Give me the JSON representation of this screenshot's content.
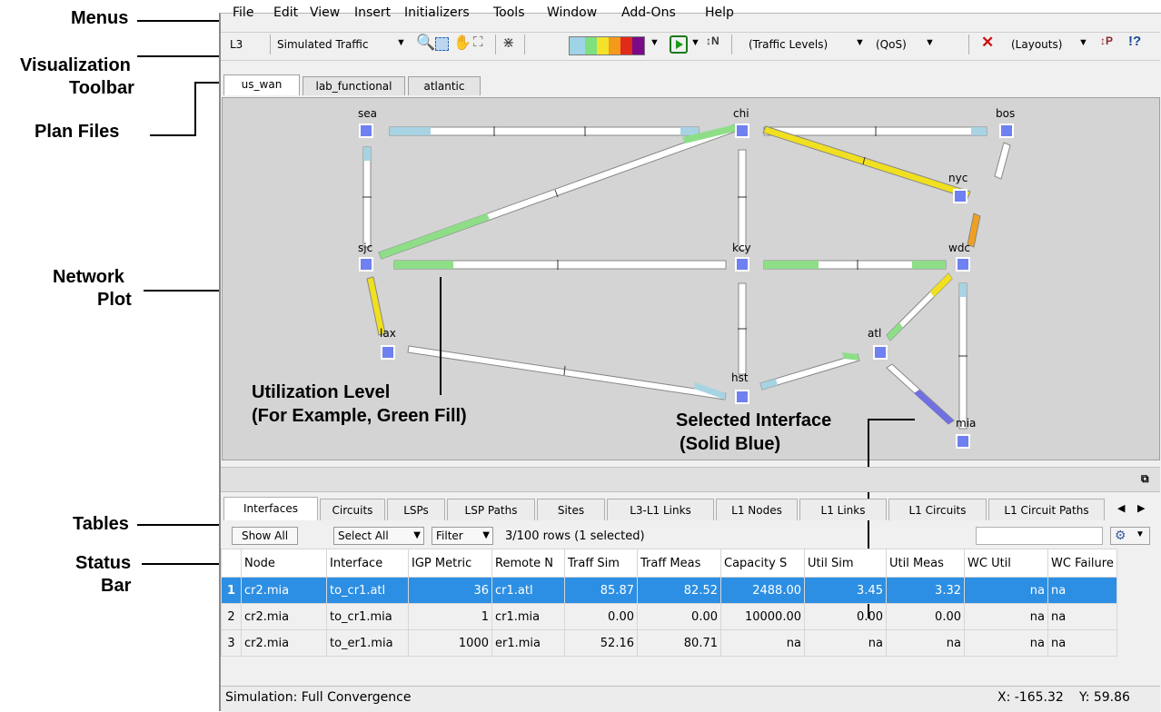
{
  "callouts": {
    "menus": "Menus",
    "viz_toolbar_1": "Visualization",
    "viz_toolbar_2": "Toolbar",
    "plan_files": "Plan Files",
    "network_plot_1": "Network",
    "network_plot_2": "Plot",
    "tables": "Tables",
    "status_bar_1": "Status",
    "status_bar_2": "Bar",
    "utilization_1": "Utilization Level",
    "utilization_2": "(For Example,  Green Fill)",
    "selected_1": "Selected Interface",
    "selected_2": "(Solid Blue)"
  },
  "menu": [
    "File",
    "Edit",
    "View",
    "Insert",
    "Initializers",
    "Tools",
    "Window",
    "Add-Ons",
    "Help"
  ],
  "toolbar": {
    "layer": "L3",
    "traffic": "Simulated Traffic",
    "traffic_levels": "(Traffic Levels)",
    "qos": "(QoS)",
    "layouts": "(Layouts)",
    "colors": [
      "#add8e6",
      "#90ee90",
      "#ffd700",
      "#ffa500",
      "#e03020",
      "#8b008b"
    ]
  },
  "plan_tabs": [
    "us_wan",
    "lab_functional",
    "atlantic"
  ],
  "nodes": [
    "sea",
    "chi",
    "bos",
    "nyc",
    "sjc",
    "kcy",
    "wdc",
    "lax",
    "atl",
    "hst",
    "mia"
  ],
  "table_tabs": [
    "Interfaces",
    "Circuits",
    "LSPs",
    "LSP Paths",
    "Sites",
    "L3-L1 Links",
    "L1 Nodes",
    "L1 Links",
    "L1 Circuits",
    "L1 Circuit Paths"
  ],
  "table_controls": {
    "show_all": "Show All",
    "select_all": "Select All",
    "filter": "Filter",
    "rows_info": "3/100 rows (1 selected)"
  },
  "columns": [
    "Node",
    "Interface",
    "IGP Metric",
    "Remote N",
    "Traff Sim",
    "Traff Meas",
    "Capacity S",
    "Util Sim",
    "Util Meas",
    "WC Util",
    "WC Failure"
  ],
  "rows": [
    [
      "1",
      "cr2.mia",
      "to_cr1.atl",
      "36",
      "cr1.atl",
      "85.87",
      "82.52",
      "2488.00",
      "3.45",
      "3.32",
      "na",
      "na"
    ],
    [
      "2",
      "cr2.mia",
      "to_cr1.mia",
      "1",
      "cr1.mia",
      "0.00",
      "0.00",
      "10000.00",
      "0.00",
      "0.00",
      "na",
      "na"
    ],
    [
      "3",
      "cr2.mia",
      "to_er1.mia",
      "1000",
      "er1.mia",
      "52.16",
      "80.71",
      "na",
      "na",
      "na",
      "na",
      "na"
    ]
  ],
  "status": {
    "text": "Simulation: Full Convergence",
    "x": "X: -165.32",
    "y": "Y: 59.86"
  }
}
